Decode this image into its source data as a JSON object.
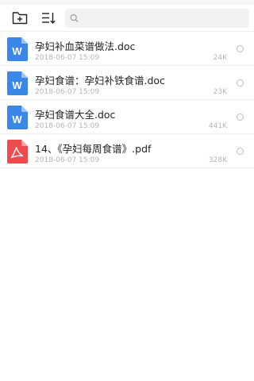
{
  "toolbar": {
    "new_folder_icon": "folder-plus-icon",
    "sort_icon": "sort-icon",
    "search_icon": "search-icon",
    "search_placeholder": "",
    "search_value": ""
  },
  "files": [
    {
      "name": "孕妇补血菜谱做法.doc",
      "date": "2018-06-07 15:09",
      "size": "24K",
      "type": "doc",
      "icon": "word-doc-icon",
      "icon_color": "#3b87e8"
    },
    {
      "name": "孕妇食谱：孕妇补铁食谱.doc",
      "date": "2018-06-07 15:09",
      "size": "23K",
      "type": "doc",
      "icon": "word-doc-icon",
      "icon_color": "#3b87e8"
    },
    {
      "name": "孕妇食谱大全.doc",
      "date": "2018-06-07 15:09",
      "size": "441K",
      "type": "doc",
      "icon": "word-doc-icon",
      "icon_color": "#3b87e8"
    },
    {
      "name": "14、《孕妇每周食谱》.pdf",
      "date": "2018-06-07 15:09",
      "size": "328K",
      "type": "pdf",
      "icon": "pdf-icon",
      "icon_color": "#ee4c4c"
    }
  ]
}
